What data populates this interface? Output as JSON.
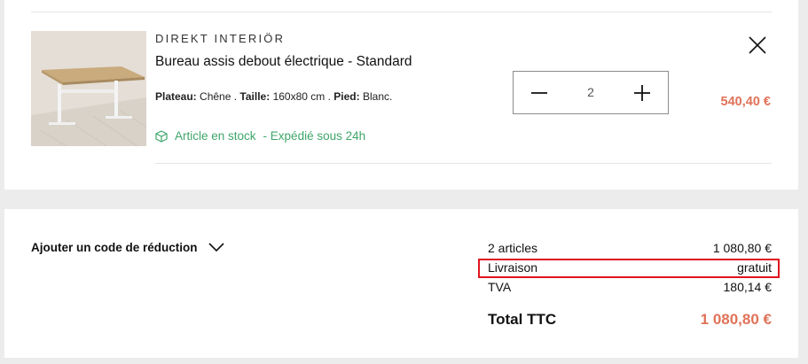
{
  "cart_item": {
    "brand": "DIREKT INTERIÖR",
    "title": "Bureau assis debout électrique - Standard",
    "attributes": [
      {
        "label": "Plateau:",
        "value": "Chêne"
      },
      {
        "label": "Taille:",
        "value": "160x80 cm"
      },
      {
        "label": "Pied:",
        "value": "Blanc."
      }
    ],
    "attr_separator": " . ",
    "stock_label": "Article en stock",
    "shipping_note": "- Expédié sous 24h",
    "quantity": "2",
    "price": "540,40 €",
    "image_alt": "Bureau assis debout électrique"
  },
  "summary": {
    "promo_label": "Ajouter un code de réduction",
    "articles_label": "2 articles",
    "articles_value": "1 080,80 €",
    "delivery_label": "Livraison",
    "delivery_value": "gratuit",
    "tax_label": "TVA",
    "tax_value": "180,14 €",
    "total_label": "Total TTC",
    "total_value": "1 080,80 €"
  },
  "colors": {
    "accent_price": "#e07258",
    "stock_green": "#3fa66a",
    "highlight_red": "#e0141e",
    "page_bg": "#ececec"
  },
  "icons": {
    "stock": "box-icon",
    "quantity_decrease": "minus-icon",
    "quantity_increase": "plus-icon",
    "remove": "close-icon",
    "promo_toggle": "chevron-down-icon"
  }
}
